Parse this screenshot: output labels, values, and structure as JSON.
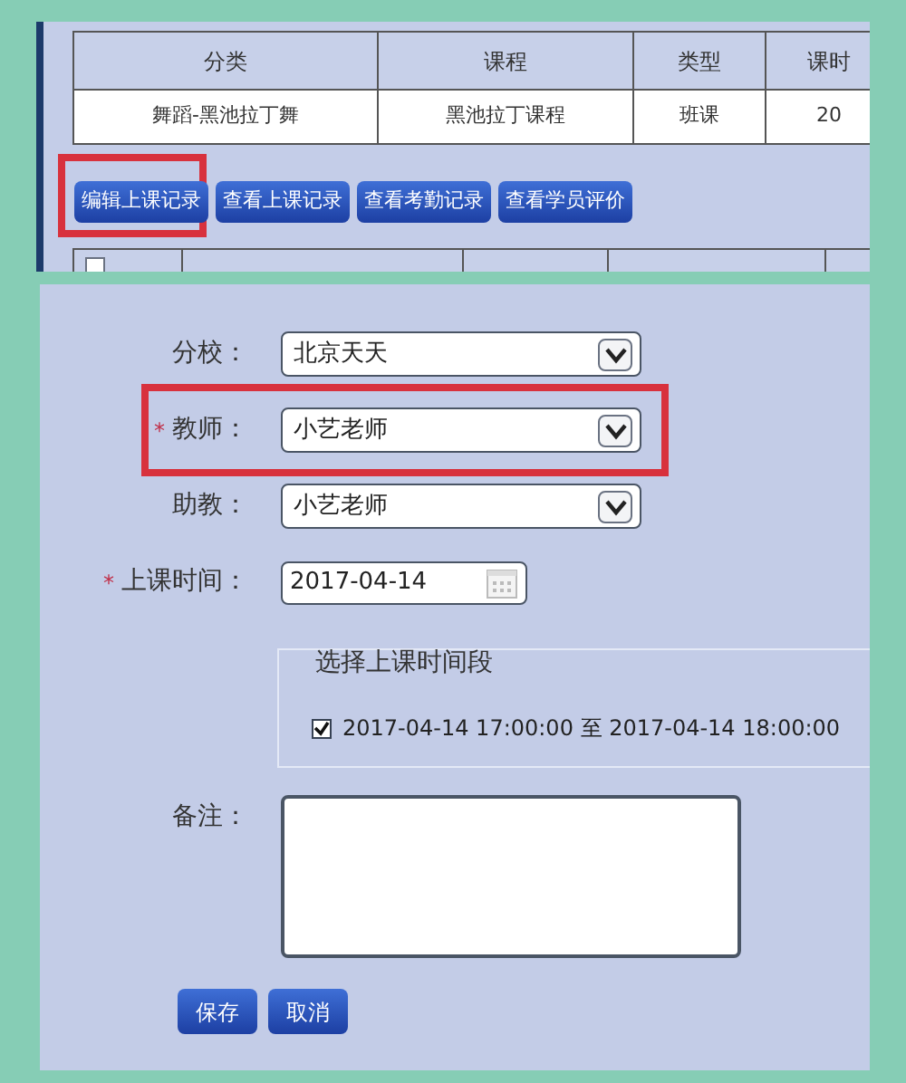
{
  "course_table": {
    "columns": [
      "分类",
      "课程",
      "类型",
      "课时"
    ],
    "rows": [
      [
        "舞蹈-黑池拉丁舞",
        "黑池拉丁课程",
        "班课",
        "20"
      ]
    ]
  },
  "actions": [
    {
      "label": "编辑上课记录",
      "highlighted": true
    },
    {
      "label": "查看上课记录",
      "highlighted": false
    },
    {
      "label": "查看考勤记录",
      "highlighted": false
    },
    {
      "label": "查看学员评价",
      "highlighted": false
    }
  ],
  "list_header": {
    "checked": false
  },
  "form": {
    "fields": [
      {
        "kind": "select",
        "label": "分校：",
        "highlighted": false,
        "value": "北京天天"
      },
      {
        "kind": "select",
        "marker": "*",
        "label": "教师：",
        "highlighted": true,
        "value": "小艺老师"
      },
      {
        "kind": "select",
        "label": "助教：",
        "highlighted": false,
        "value": "小艺老师"
      },
      {
        "kind": "date",
        "marker": "*",
        "label": "上课时间：",
        "highlighted": false,
        "value": "2017-04-14"
      }
    ],
    "time_slots": {
      "legend": "选择上课时间段",
      "options": [
        {
          "label": "2017-04-14 17:00:00 至 2017-04-14 18:00:00",
          "checked": true
        }
      ]
    },
    "note": {
      "label": "备注："
    },
    "buttons": [
      "保存",
      "取消"
    ]
  }
}
